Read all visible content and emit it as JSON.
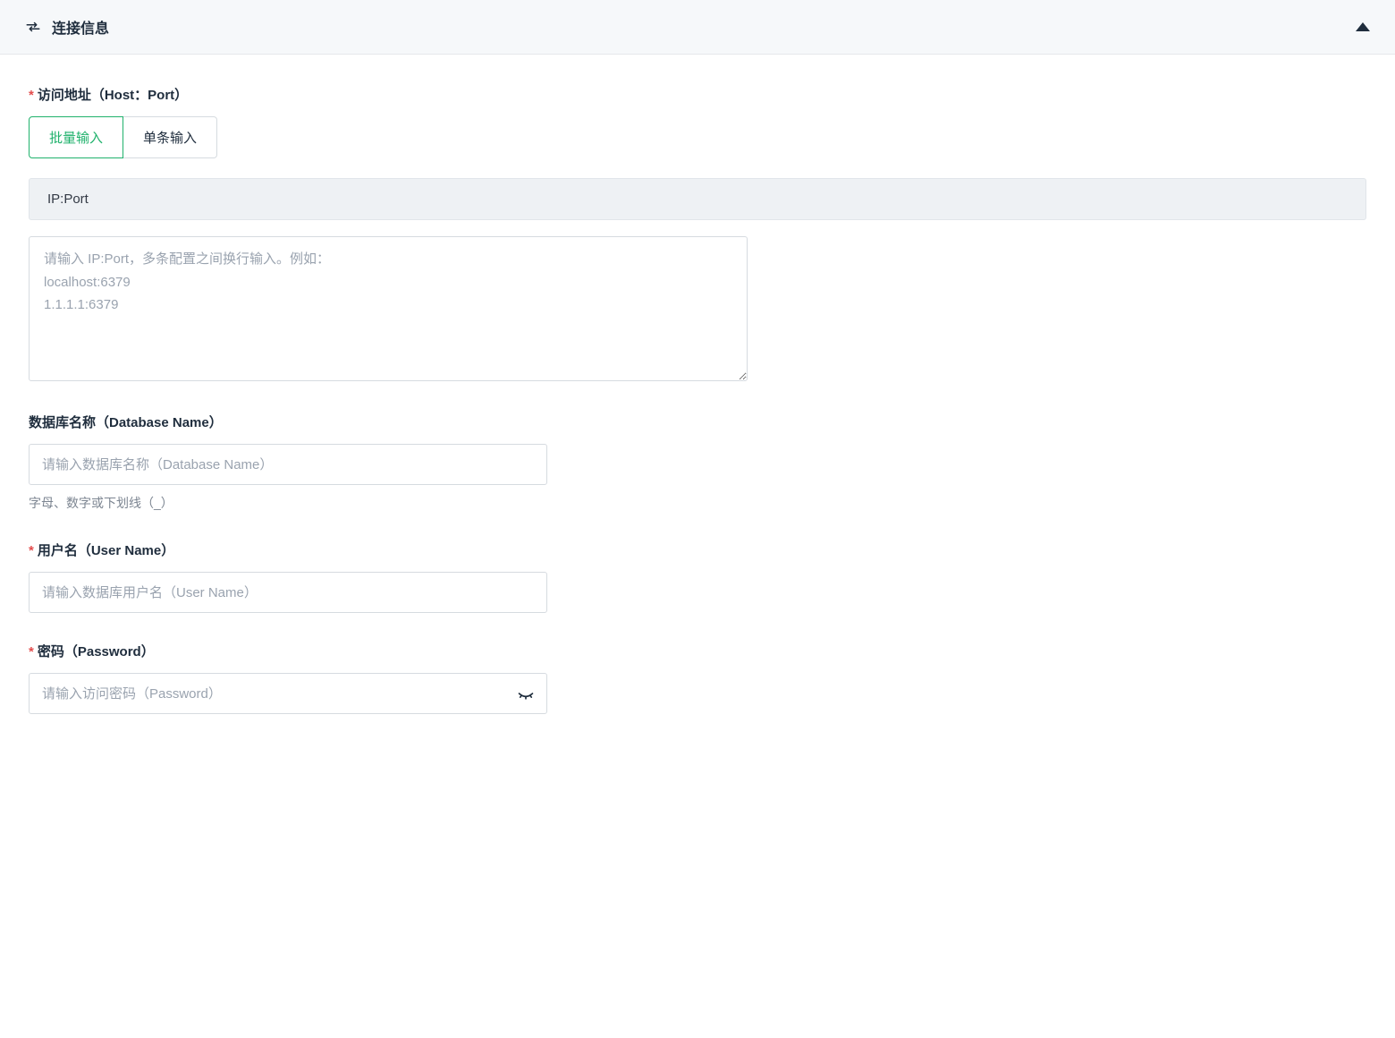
{
  "panel": {
    "title": "连接信息"
  },
  "host": {
    "label": "访问地址（Host：Port）",
    "tabs": {
      "batch": "批量输入",
      "single": "单条输入"
    },
    "columnHeader": "IP:Port",
    "placeholder": "请输入 IP:Port，多条配置之间换行输入。例如：\nlocalhost:6379\n1.1.1.1:6379"
  },
  "dbname": {
    "label": "数据库名称（Database Name）",
    "placeholder": "请输入数据库名称（Database Name）",
    "help": "字母、数字或下划线（_）"
  },
  "username": {
    "label": "用户名（User Name）",
    "placeholder": "请输入数据库用户名（User Name）"
  },
  "password": {
    "label": "密码（Password）",
    "placeholder": "请输入访问密码（Password）"
  }
}
